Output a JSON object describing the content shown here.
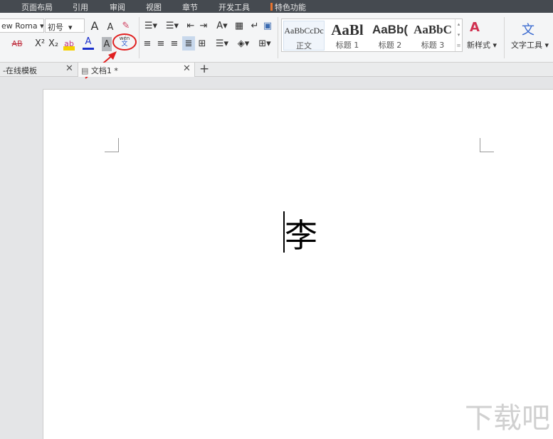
{
  "menu": {
    "items": [
      "页面布局",
      "引用",
      "审阅",
      "视图",
      "章节",
      "开发工具",
      "特色功能"
    ]
  },
  "toolbar": {
    "font_name": "ew Roma",
    "font_size": "初号",
    "grow_font": "A",
    "shrink_font": "A",
    "strike": "AB",
    "superscript": "X²",
    "subscript": "X₂",
    "highlight": "ab",
    "font_color": "A",
    "char_shade": "A",
    "phonetic_top": "wén",
    "phonetic_bottom": "文",
    "styles": [
      {
        "sample": "AaBbCcDc",
        "label": "正文"
      },
      {
        "sample": "AaBl",
        "label": "标题 1"
      },
      {
        "sample": "AaBb(",
        "label": "标题 2"
      },
      {
        "sample": "AaBbC",
        "label": "标题 3"
      }
    ],
    "new_style": "新样式",
    "text_tools": "文字工具"
  },
  "tabs": [
    {
      "label": "-在线模板"
    },
    {
      "label": "文档1 *"
    }
  ],
  "add_tab": "+",
  "document": {
    "text": "李"
  },
  "watermark": "下载吧 www.xiazaiba.com",
  "colors": {
    "menubar": "#454a50",
    "annotation": "#e02020",
    "accent": "#e8742e"
  }
}
